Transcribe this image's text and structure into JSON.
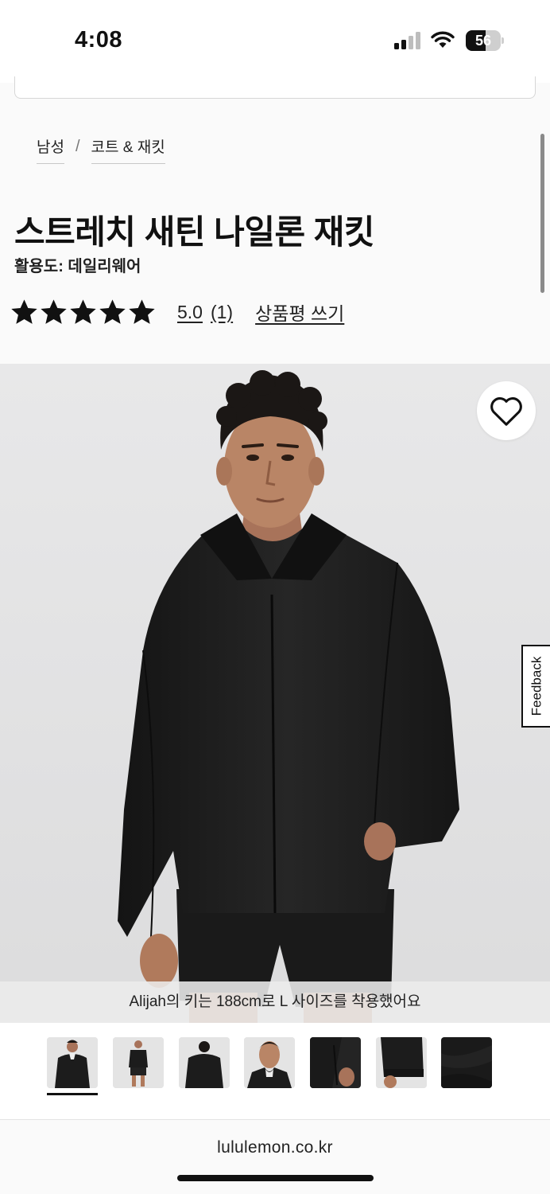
{
  "status_bar": {
    "time": "4:08",
    "battery_level": "56",
    "battery_fraction": 0.56
  },
  "breadcrumb": [
    {
      "label": "남성"
    },
    {
      "label": "코트 & 재킷"
    }
  ],
  "breadcrumb_separator": "/",
  "product": {
    "title": "스트레치 새틴 나일론 재킷",
    "activity": "활용도: 데일리웨어",
    "rating": {
      "stars": 5,
      "max_stars": 5,
      "value": "5.0",
      "count": "(1)"
    },
    "write_review_label": "상품평 쓰기"
  },
  "hero": {
    "caption": "Alijah의 키는 188cm로 L 사이즈를 착용했어요",
    "feedback_label": "Feedback",
    "colors": {
      "background": "#e3e3e4",
      "jacket": "#1f1f1f",
      "tee": "#f2f2f2",
      "skin": "#b98566",
      "hair": "#1b1715"
    }
  },
  "thumbnails": {
    "count": 7,
    "active_index": 0,
    "items": [
      {
        "name": "front-view"
      },
      {
        "name": "full-body-view"
      },
      {
        "name": "back-view"
      },
      {
        "name": "collar-closeup"
      },
      {
        "name": "pocket-detail"
      },
      {
        "name": "sleeve-detail"
      },
      {
        "name": "fabric-detail"
      }
    ]
  },
  "browser": {
    "url": "lululemon.co.kr"
  }
}
